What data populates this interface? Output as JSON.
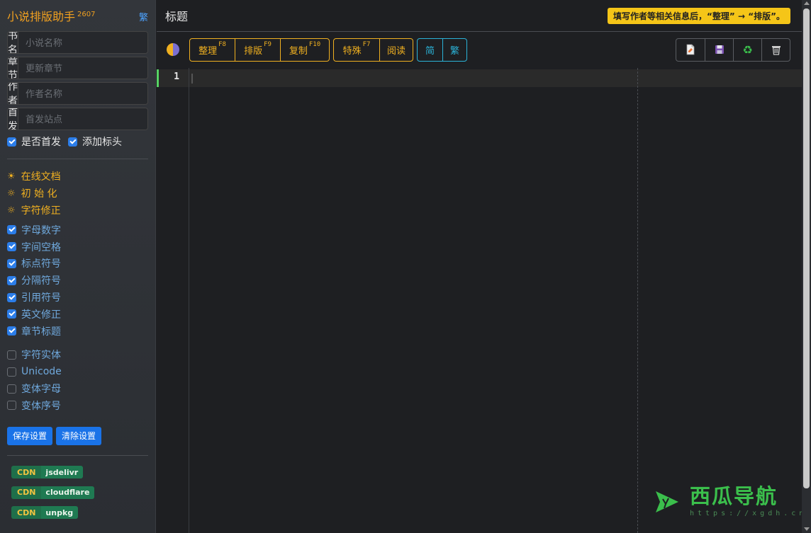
{
  "sidebar": {
    "app_title": "小说排版助手",
    "version": "2607",
    "trad_link": "繁",
    "fields": [
      {
        "label": "书名",
        "placeholder": "小说名称"
      },
      {
        "label": "章节",
        "placeholder": "更新章节"
      },
      {
        "label": "作者",
        "placeholder": "作者名称"
      },
      {
        "label": "首发",
        "placeholder": "首发站点"
      }
    ],
    "first_publish_label": "是否首发",
    "add_header_label": "添加标头",
    "actions": [
      {
        "label": "在线文档",
        "icon": "sun-filled-icon"
      },
      {
        "label": "初 始 化",
        "icon": "sun-outline-icon"
      },
      {
        "label": "字符修正",
        "icon": "sun-outline-icon"
      }
    ],
    "options_checked": [
      "字母数字",
      "字间空格",
      "标点符号",
      "分隔符号",
      "引用符号",
      "英文修正",
      "章节标题"
    ],
    "options_unchecked": [
      "字符实体",
      "Unicode",
      "变体字母",
      "变体序号"
    ],
    "save_label": "保存设置",
    "clear_label": "清除设置",
    "cdn": [
      {
        "tag": "CDN",
        "name": "jsdelivr"
      },
      {
        "tag": "CDN",
        "name": "cloudflare"
      },
      {
        "tag": "CDN",
        "name": "unpkg"
      }
    ]
  },
  "main": {
    "title": "标题",
    "hint": "填写作者等相关信息后，“整理” → “排版”。",
    "toolbar": {
      "group1": [
        {
          "label": "整理",
          "key": "F8"
        },
        {
          "label": "排版",
          "key": "F9"
        },
        {
          "label": "复制",
          "key": "F10"
        }
      ],
      "group2": [
        {
          "label": "特殊",
          "key": "F7"
        },
        {
          "label": "阅读",
          "key": ""
        }
      ],
      "group3": [
        {
          "label": "简"
        },
        {
          "label": "繁"
        }
      ]
    },
    "right_tools": [
      "new-file-icon",
      "save-disk-icon",
      "recycle-icon",
      "trash-icon"
    ],
    "editor": {
      "line_number": "1"
    }
  },
  "watermark": {
    "title": "西瓜导航",
    "url": "https://xgdh.cn"
  },
  "colors": {
    "accent_orange": "#f0b020",
    "accent_cyan": "#2bb3d8",
    "accent_blue": "#1a73e8",
    "hint_yellow": "#f5c518",
    "active_line_marker": "#56d364"
  }
}
